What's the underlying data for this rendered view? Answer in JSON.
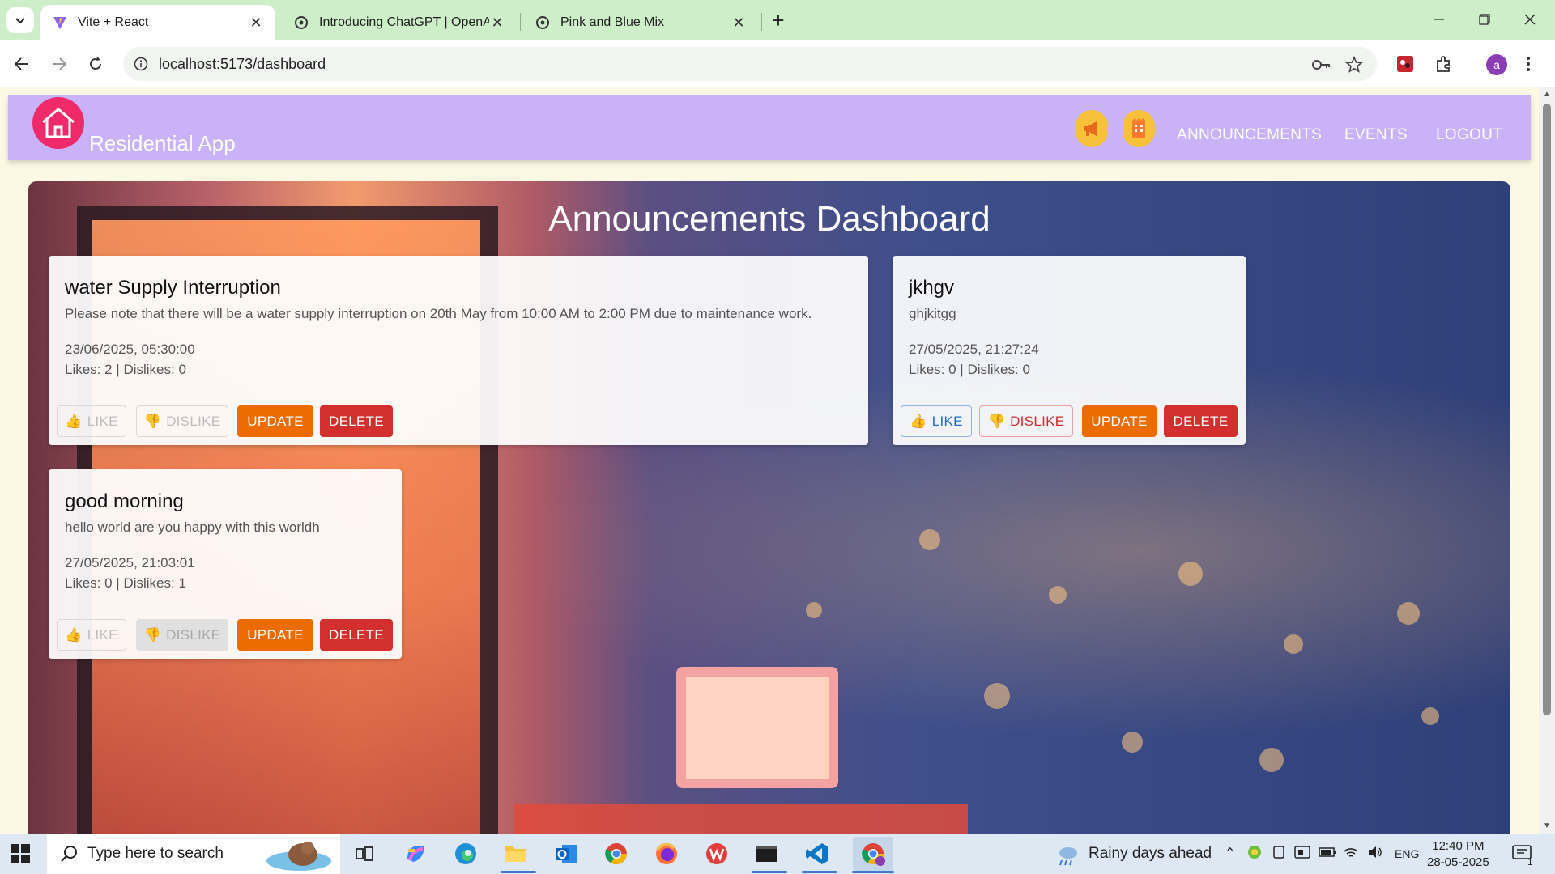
{
  "browser": {
    "tabs": [
      {
        "title": "Vite + React",
        "active": true,
        "icon": "vite-icon"
      },
      {
        "title": "Introducing ChatGPT | OpenAI",
        "active": false,
        "icon": "openai-icon"
      },
      {
        "title": "Pink and Blue Mix",
        "active": false,
        "icon": "openai-icon"
      }
    ],
    "url": "localhost:5173/dashboard",
    "profile_initial": "a"
  },
  "app": {
    "title": "Residential App",
    "nav_links": [
      "ANNOUNCEMENTS",
      "EVENTS",
      "LOGOUT"
    ]
  },
  "dashboard": {
    "heading": "Announcements Dashboard",
    "button_labels": {
      "like": "LIKE",
      "dislike": "DISLIKE",
      "update": "UPDATE",
      "delete": "DELETE"
    },
    "announcements": [
      {
        "title": "water Supply Interruption",
        "description": "Please note that there will be a water supply interruption on 20th May from 10:00 AM to 2:00 PM due to maintenance work.",
        "datetime": "23/06/2025, 05:30:00",
        "counts": "Likes: 2 | Dislikes: 0",
        "state": "liked"
      },
      {
        "title": "jkhgv",
        "description": "ghjkitgg",
        "datetime": "27/05/2025, 21:27:24",
        "counts": "Likes: 0 | Dislikes: 0",
        "state": "none"
      },
      {
        "title": "good morning",
        "description": "hello world are you happy with this worldh",
        "datetime": "27/05/2025, 21:03:01",
        "counts": "Likes: 0 | Dislikes: 1",
        "state": "disliked"
      }
    ]
  },
  "taskbar": {
    "search_placeholder": "Type here to search",
    "weather": "Rainy days ahead",
    "language": "ENG",
    "time": "12:40 PM",
    "date": "28-05-2025",
    "notification_count": "1"
  },
  "colors": {
    "navbar": "#c9b2f7",
    "update": "#ed6c02",
    "delete": "#d32f2f",
    "like_active": "#1e6fc3",
    "dislike_active": "#c8302f"
  }
}
